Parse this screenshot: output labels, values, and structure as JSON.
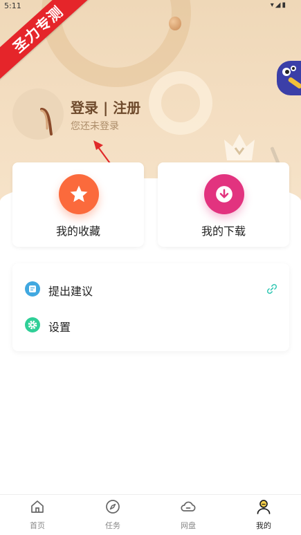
{
  "status_bar": {
    "time": "5:11",
    "icons": "▾◢▮"
  },
  "ribbon": {
    "text": "圣力专测"
  },
  "profile": {
    "title": "登录 | 注册",
    "subtitle": "您还未登录"
  },
  "cards": [
    {
      "label": "我的收藏",
      "icon": "star-icon",
      "color": "#fb6a3c"
    },
    {
      "label": "我的下载",
      "icon": "download-icon",
      "color": "#e2337f"
    }
  ],
  "menu": [
    {
      "label": "提出建议",
      "icon": "feedback-icon",
      "color": "#41a8e0"
    },
    {
      "label": "设置",
      "icon": "gear-icon",
      "color": "#2fcf97"
    }
  ],
  "tabs": [
    {
      "label": "首页",
      "icon": "home-icon"
    },
    {
      "label": "任务",
      "icon": "compass-icon"
    },
    {
      "label": "网盘",
      "icon": "cloud-icon"
    },
    {
      "label": "我的",
      "icon": "user-icon",
      "active": true
    }
  ],
  "colors": {
    "accent_text": "#6e4a2c",
    "link_icon": "#39c9b6"
  }
}
